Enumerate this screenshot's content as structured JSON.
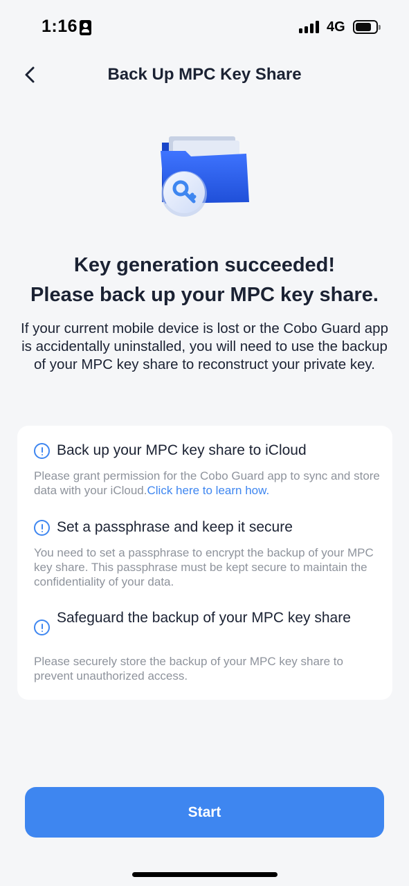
{
  "status_bar": {
    "time": "1:16",
    "network": "4G",
    "battery_level": 0.8
  },
  "header": {
    "title": "Back Up MPC Key Share",
    "back_icon": "chevron-left-icon"
  },
  "hero": {
    "illustration": "folder-key-illustration",
    "colors": {
      "folder": "#2c5fe8",
      "key": "#3e86f0"
    }
  },
  "headline": {
    "line1": "Key generation succeeded!",
    "line2": "Please back up your MPC key share."
  },
  "description": "If your current mobile device is lost or the Cobo Guard app is accidentally uninstalled, you will need to use the backup of your MPC key share to reconstruct your private key.",
  "tips": [
    {
      "icon": "info-circle-icon",
      "title": "Back up your MPC key share to iCloud",
      "body": "Please grant permission for the Cobo Guard app to sync and store data with your iCloud.",
      "link": "Click here to learn how."
    },
    {
      "icon": "info-circle-icon",
      "title": "Set a passphrase and keep it secure",
      "body": "You need to set a passphrase to encrypt the backup of your MPC key share. This passphrase must be kept secure to maintain the confidentiality of your data."
    },
    {
      "icon": "info-circle-icon",
      "title": "Safeguard the backup of your MPC key share",
      "body": "Please securely store the backup of your MPC key share to prevent unauthorized access."
    }
  ],
  "start_button": {
    "label": "Start"
  },
  "colors": {
    "accent": "#3e86f0",
    "background": "#f5f6f8",
    "text_primary": "#1b2233",
    "text_secondary": "#8e939c"
  }
}
